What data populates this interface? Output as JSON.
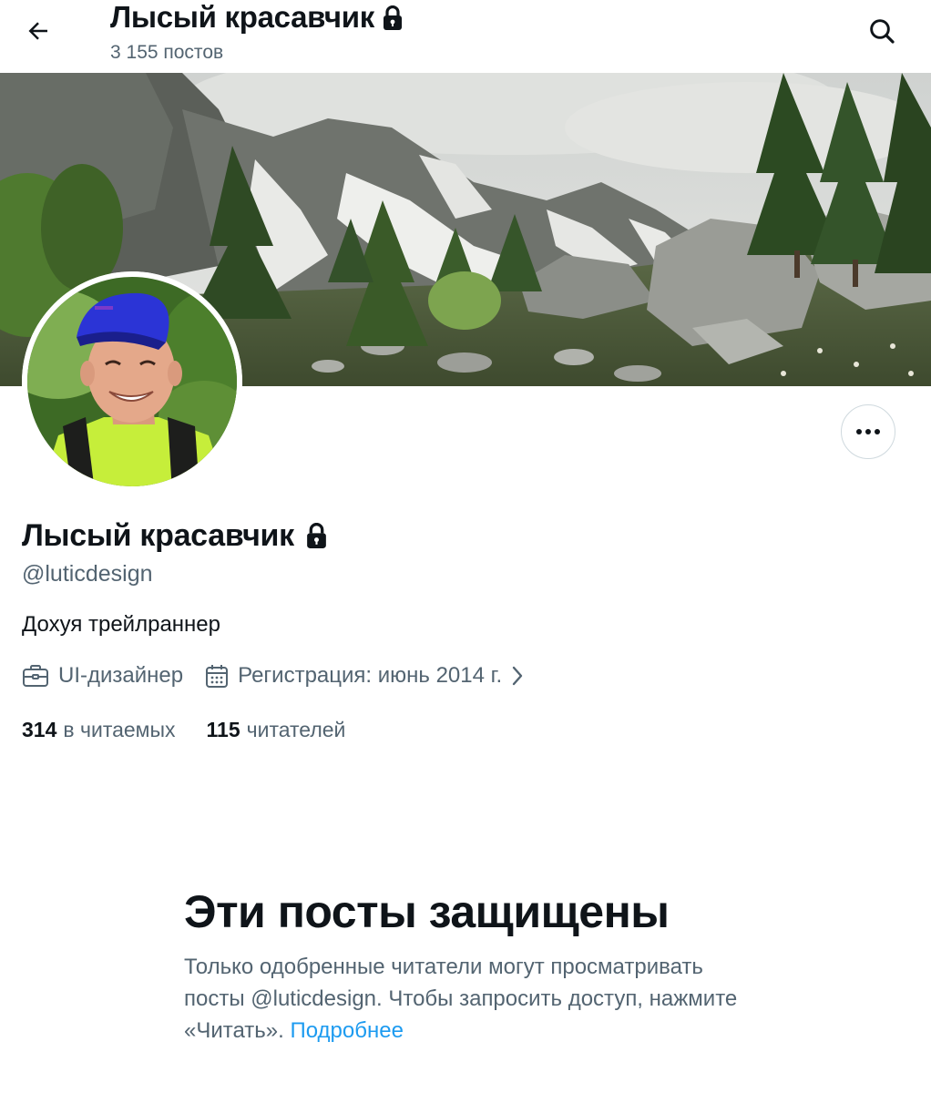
{
  "header": {
    "title": "Лысый красавчик",
    "posts_count": "3 155 постов"
  },
  "profile": {
    "name": "Лысый красавчик",
    "handle": "@luticdesign",
    "bio": "Дохуя трейлраннер",
    "profession": "UI-дизайнер",
    "joined": "Регистрация: июнь 2014 г.",
    "following_count": "314",
    "following_label": "в читаемых",
    "followers_count": "115",
    "followers_label": "читателей"
  },
  "protected": {
    "title": "Эти посты защищены",
    "text": "Только одобренные читатели могут просматривать посты @luticdesign. Чтобы запросить доступ, нажмите «Читать».",
    "learn_more": "Подробнее"
  },
  "icons": {
    "back": "arrow-left-icon",
    "search": "search-icon",
    "lock": "lock-icon",
    "more": "more-horizontal-icon",
    "profession": "briefcase-icon",
    "joined": "calendar-icon",
    "chevron": "chevron-right-icon"
  },
  "colors": {
    "text_primary": "#0f1419",
    "text_secondary": "#536471",
    "link": "#1d9bf0",
    "border": "#cfd9de"
  }
}
